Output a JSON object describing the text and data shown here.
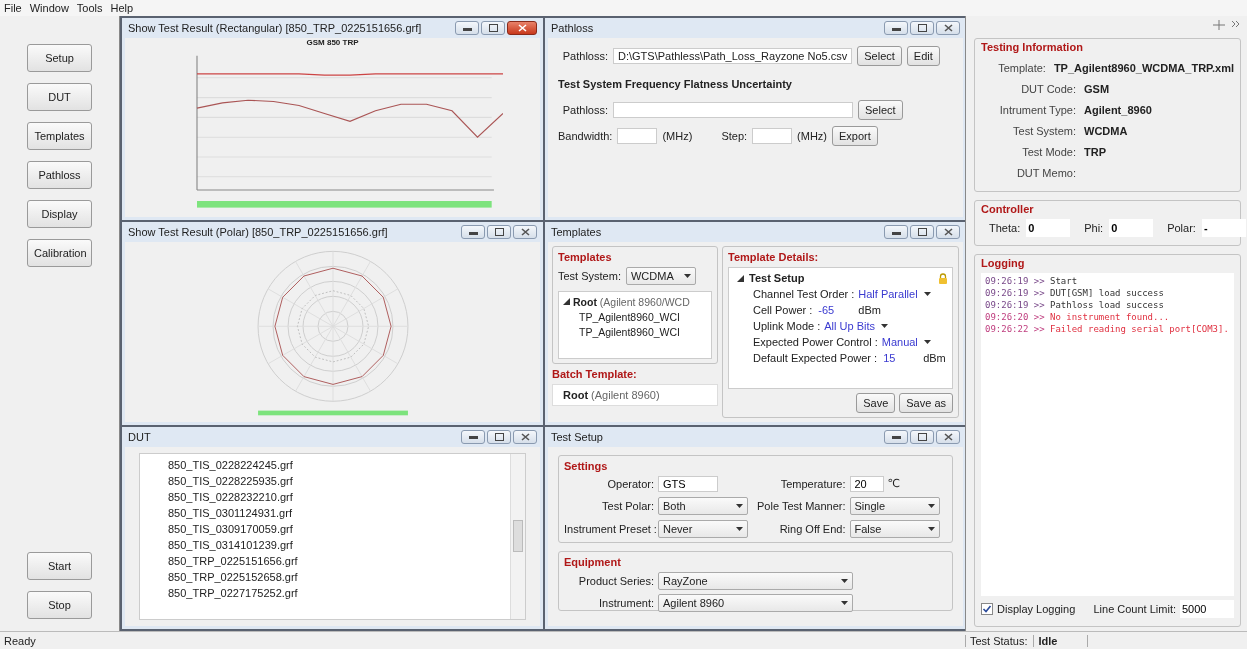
{
  "menu": [
    "File",
    "Window",
    "Tools",
    "Help"
  ],
  "nav_buttons": [
    "Setup",
    "DUT",
    "Templates",
    "Pathloss",
    "Display",
    "Calibration"
  ],
  "action_buttons": [
    "Start",
    "Stop"
  ],
  "rect_panel": {
    "title": "Show Test Result (Rectangular) [850_TRP_0225151656.grf]",
    "active": true,
    "chart_title": "GSM 850 TRP"
  },
  "polar_panel": {
    "title": "Show Test Result (Polar) [850_TRP_0225151656.grf]",
    "active": false
  },
  "pathloss_panel": {
    "title": "Pathloss",
    "active": false,
    "pathloss_label": "Pathloss:",
    "pathloss_value": "D:\\GTS\\Pathless\\Path_Loss_Rayzone No5.csv",
    "select": "Select",
    "edit": "Edit",
    "heading": "Test System Frequency Flatness Uncertainty",
    "pathloss2_label": "Pathloss:",
    "select2": "Select",
    "bandwidth_label": "Bandwidth:",
    "bandwidth_unit": "(MHz)",
    "step_label": "Step:",
    "step_unit": "(MHz)",
    "export": "Export"
  },
  "templates_panel": {
    "title": "Templates",
    "active": false,
    "group": "Templates",
    "test_system_label": "Test System:",
    "test_system": "WCDMA",
    "tree": {
      "name": "Root",
      "detail": "(Agilent 8960/WCD",
      "expanded": true,
      "children": [
        {
          "name": "TP_Agilent8960_WCI"
        },
        {
          "name": "TP_Agilent8960_WCI"
        }
      ]
    },
    "batch_group": "Batch Template:",
    "batch": {
      "name": "Root",
      "detail": "(Agilent 8960)"
    },
    "details_group": "Template Details:",
    "section": {
      "name": "Test Setup",
      "expanded": true
    },
    "properties": [
      {
        "kind": "dropdown",
        "label": "Channel Test Order :",
        "value": "Half Parallel"
      },
      {
        "kind": "field",
        "label": "Cell Power :",
        "value": "-65",
        "unit": "dBm"
      },
      {
        "kind": "dropdown",
        "label": "Uplink Mode :",
        "value": "All Up Bits"
      },
      {
        "kind": "dropdown",
        "label": "Expected Power Control :",
        "value": "Manual"
      },
      {
        "kind": "field",
        "label": "Default Expected Power :",
        "value": "15",
        "unit": "dBm"
      }
    ],
    "save": "Save",
    "save_as": "Save as"
  },
  "dut_panel": {
    "title": "DUT",
    "active": false,
    "files": [
      "850_TIS_0228224245.grf",
      "850_TIS_0228225935.grf",
      "850_TIS_0228232210.grf",
      "850_TIS_0301124931.grf",
      "850_TIS_0309170059.grf",
      "850_TIS_0314101239.grf",
      "850_TRP_0225151656.grf",
      "850_TRP_0225152658.grf",
      "850_TRP_0227175252.grf"
    ]
  },
  "test_setup_panel": {
    "title": "Test Setup",
    "active": false,
    "settings_group": "Settings",
    "settings": [
      {
        "kind": "field",
        "label": "Operator:",
        "value": "GTS"
      },
      {
        "kind": "field",
        "label": "Temperature:",
        "value": "20",
        "unit": "℃"
      },
      {
        "kind": "dropdown",
        "label": "Test Polar:",
        "value": "Both"
      },
      {
        "kind": "dropdown",
        "label": "Pole Test Manner:",
        "value": "Single"
      },
      {
        "kind": "dropdown",
        "label": "Instrument Preset :",
        "value": "Never"
      },
      {
        "kind": "dropdown",
        "label": "Ring Off End:",
        "value": "False"
      }
    ],
    "equipment_group": "Equipment",
    "equipment": [
      {
        "label": "Product Series:",
        "value": "RayZone"
      },
      {
        "label": "Instrument:",
        "value": "Agilent 8960"
      }
    ]
  },
  "testing_info": {
    "heading": "Testing Information",
    "rows": [
      {
        "label": "Template:",
        "value": "TP_Agilent8960_WCDMA_TRP.xml"
      },
      {
        "label": "DUT Code:",
        "value": "GSM"
      },
      {
        "label": "Intrument Type:",
        "value": "Agilent_8960"
      },
      {
        "label": "Test System:",
        "value": "WCDMA"
      },
      {
        "label": "Test Mode:",
        "value": "TRP"
      },
      {
        "label": "DUT Memo:",
        "value": ""
      }
    ]
  },
  "controller": {
    "heading": "Controller",
    "fields": [
      {
        "label": "Theta:",
        "value": "0"
      },
      {
        "label": "Phi:",
        "value": "0"
      },
      {
        "label": "Polar:",
        "value": "-"
      }
    ]
  },
  "logging": {
    "heading": "Logging",
    "entries": [
      {
        "kind": "info",
        "time": "09:26:19 >>",
        "text": "Start"
      },
      {
        "kind": "info",
        "time": "09:26:19 >>",
        "text": "DUT[GSM] load success"
      },
      {
        "kind": "info",
        "time": "09:26:19 >>",
        "text": "Pathloss load success"
      },
      {
        "kind": "error",
        "time": "09:26:20 >>",
        "text": "No instrument found..."
      },
      {
        "kind": "error",
        "time": "09:26:22 >>",
        "text": "Failed reading serial port[COM3]."
      }
    ],
    "display_logging": {
      "label": "Display Logging",
      "checked": true
    },
    "limit_label": "Line Count Limit:",
    "limit": "5000"
  },
  "status_bar": {
    "left": "Ready",
    "status_label": "Test Status:",
    "status": "Idle"
  }
}
